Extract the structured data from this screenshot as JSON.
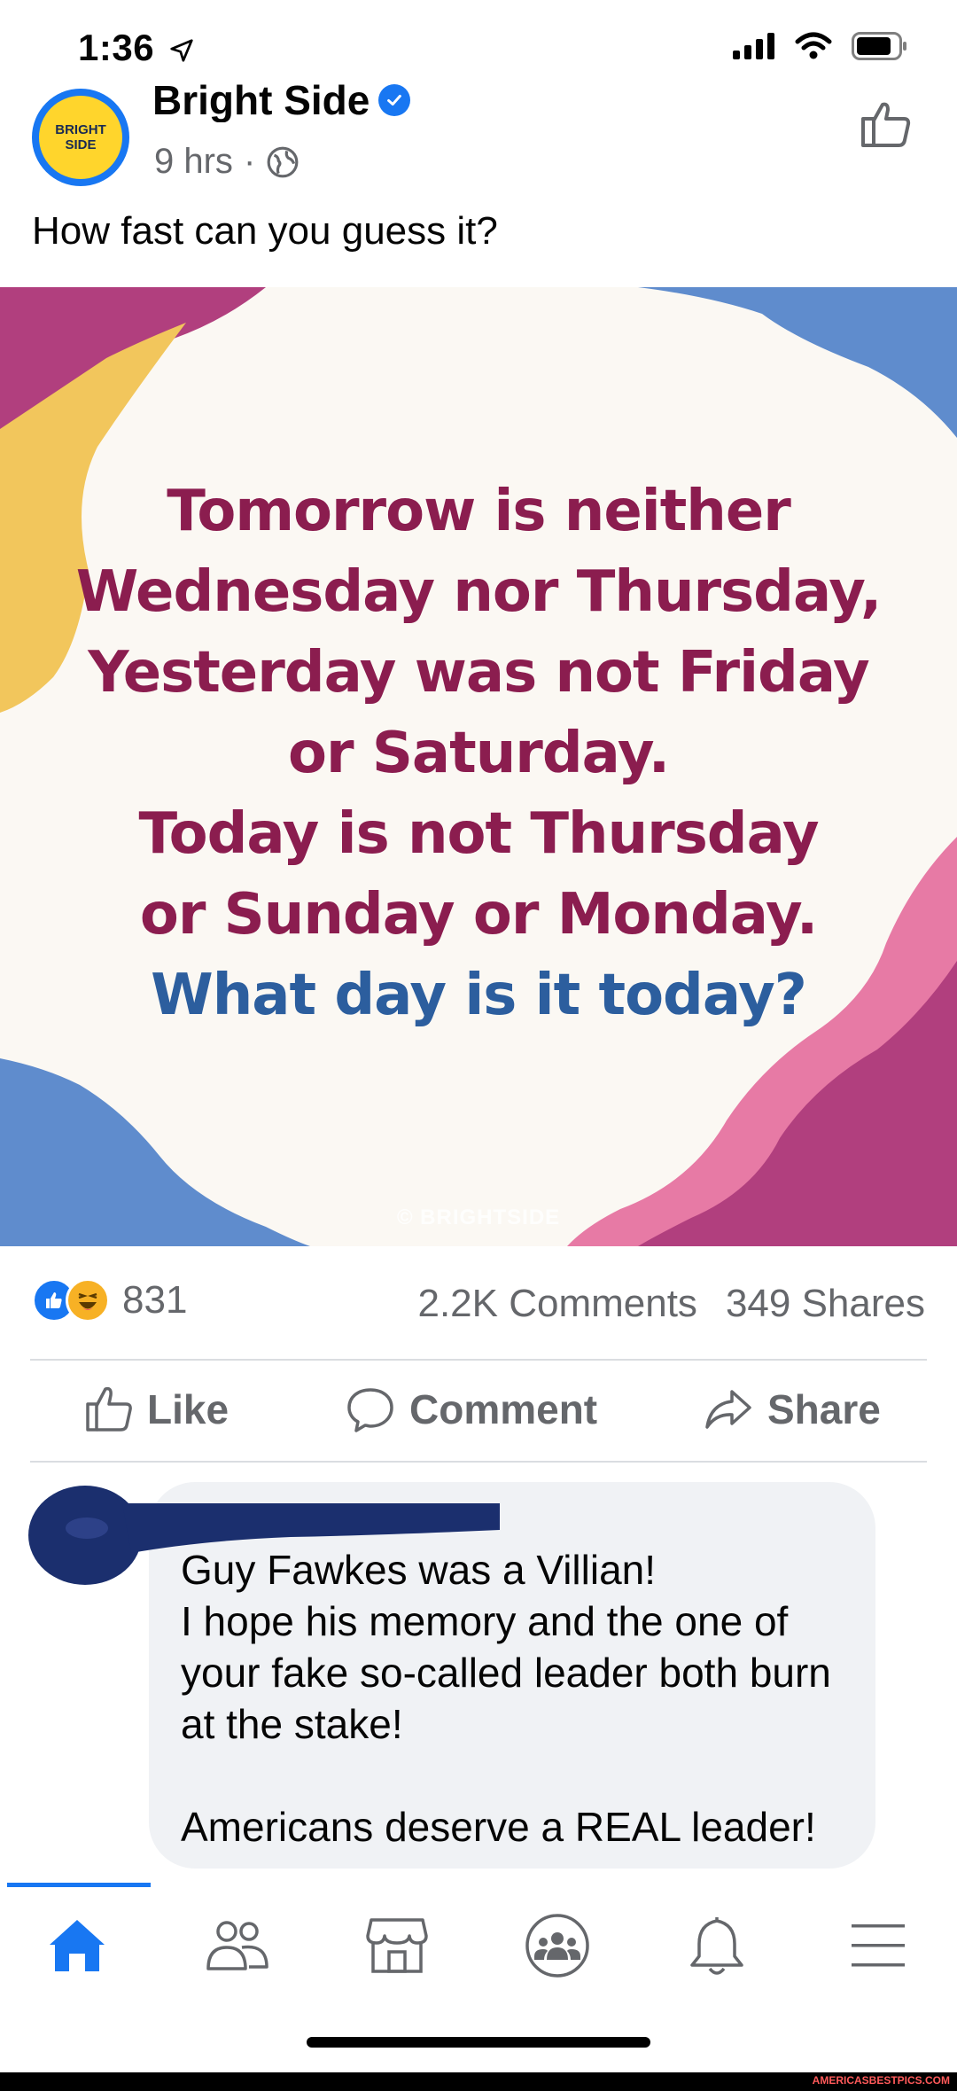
{
  "status_bar": {
    "time": "1:36"
  },
  "post": {
    "page_name": "Bright Side",
    "avatar_text_line1": "BRIGHT",
    "avatar_text_line2": "SIDE",
    "time_ago": "9 hrs",
    "separator": "·",
    "caption": "How fast can you guess it?",
    "image": {
      "lines": [
        "Tomorrow is neither",
        "Wednesday nor Thursday,",
        "Yesterday was not Friday",
        "or Saturday.",
        "Today is not Thursday",
        "or Sunday or Monday."
      ],
      "question": "What day is it today?",
      "watermark": "© BRIGHTSIDE"
    },
    "reaction_count": "831",
    "comments_count": "2.2K Comments",
    "shares_count": "349 Shares",
    "actions": {
      "like": "Like",
      "comment": "Comment",
      "share": "Share"
    }
  },
  "comment": {
    "text": "Guy Fawkes was a Villian!\nI hope his memory and the one of your fake so-called leader both burn at the stake!\n\nAmericans deserve a REAL leader!"
  },
  "watermark_footer": "AMERICASBESTPICS.COM",
  "colors": {
    "facebook_blue": "#1877f2",
    "image_text_red": "#8b1d4f",
    "image_text_blue": "#2c5e9e",
    "bubble_gray": "#f0f2f5"
  },
  "icons": [
    "location-arrow-icon",
    "signal-icon",
    "wifi-icon",
    "battery-icon",
    "verified-icon",
    "globe-icon",
    "follow-icon",
    "like-icon",
    "comment-icon",
    "share-icon",
    "home-icon",
    "friends-icon",
    "marketplace-icon",
    "groups-icon",
    "bell-icon",
    "menu-icon"
  ]
}
